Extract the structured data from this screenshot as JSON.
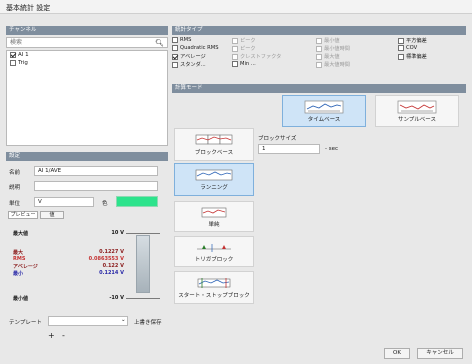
{
  "window": {
    "title": "基本統計 設定"
  },
  "channels_panel": {
    "header": "チャンネル",
    "search": {
      "value": "",
      "placeholder": "検索"
    },
    "items": [
      {
        "label": "AI 1",
        "checked": true
      },
      {
        "label": "Trig",
        "checked": false
      }
    ]
  },
  "statistics_panel": {
    "header": "統計タイプ",
    "options": [
      {
        "label": "RMS",
        "checked": false,
        "enabled": true
      },
      {
        "label": "Quadratic RMS",
        "checked": false,
        "enabled": true
      },
      {
        "label": "アベレージ",
        "checked": true,
        "enabled": true
      },
      {
        "label": "スタンダ...",
        "checked": false,
        "enabled": true
      },
      {
        "label": "ピーク",
        "checked": false,
        "enabled": false
      },
      {
        "label": "ピーク",
        "checked": false,
        "enabled": false
      },
      {
        "label": "クレストファクタ",
        "checked": false,
        "enabled": false
      },
      {
        "label": "Min ...",
        "checked": false,
        "enabled": true
      },
      {
        "label": "最小値",
        "checked": false,
        "enabled": false
      },
      {
        "label": "最小値時間",
        "checked": false,
        "enabled": false
      },
      {
        "label": "最大値",
        "checked": false,
        "enabled": false
      },
      {
        "label": "最大値時間",
        "checked": false,
        "enabled": false
      },
      {
        "label": "平方偏差",
        "checked": false,
        "enabled": true
      },
      {
        "label": "COV",
        "checked": false,
        "enabled": true
      },
      {
        "label": "標準偏差",
        "checked": false,
        "enabled": true
      }
    ]
  },
  "calc_mode_panel": {
    "header": "計算モード",
    "cards": [
      {
        "label": "タイムベース",
        "selected": true
      },
      {
        "label": "サンプルベース",
        "selected": false
      }
    ],
    "block_size_label": "ブロックサイズ",
    "block_size_value": "1",
    "block_size_unit": "sec"
  },
  "block_types": [
    {
      "label": "ブロックベース",
      "selected": false
    },
    {
      "label": "ランニング",
      "selected": true
    },
    {
      "label": "単純",
      "selected": false
    },
    {
      "label": "トリガブロック",
      "selected": false
    },
    {
      "label": "スタート・ストップブロック",
      "selected": false
    }
  ],
  "settings_panel": {
    "header": "設定",
    "name_label": "名前",
    "name_value": "AI 1/AVE",
    "desc_label": "説明",
    "desc_value": "",
    "unit_label": "単位",
    "unit_value": "V",
    "color_label": "色",
    "color_value": "#2de38c",
    "tabs": [
      "プレビュー",
      "値"
    ],
    "max_label": "最大値",
    "max_value": "10 V",
    "stats": [
      {
        "label": "最大",
        "value": "0.1227 V"
      },
      {
        "label": "RMS",
        "value": "0.0863553 V"
      },
      {
        "label": "アベレージ",
        "value": "0.122 V"
      },
      {
        "label": "最小",
        "value": "0.1214 V"
      }
    ],
    "min_label": "最小値",
    "min_value": "-10 V",
    "template_label": "テンプレート",
    "template_value": "",
    "template_action": "上書き保存",
    "add_label": "+",
    "remove_label": "-"
  },
  "footer": {
    "ok": "OK",
    "cancel": "キャンセル"
  }
}
